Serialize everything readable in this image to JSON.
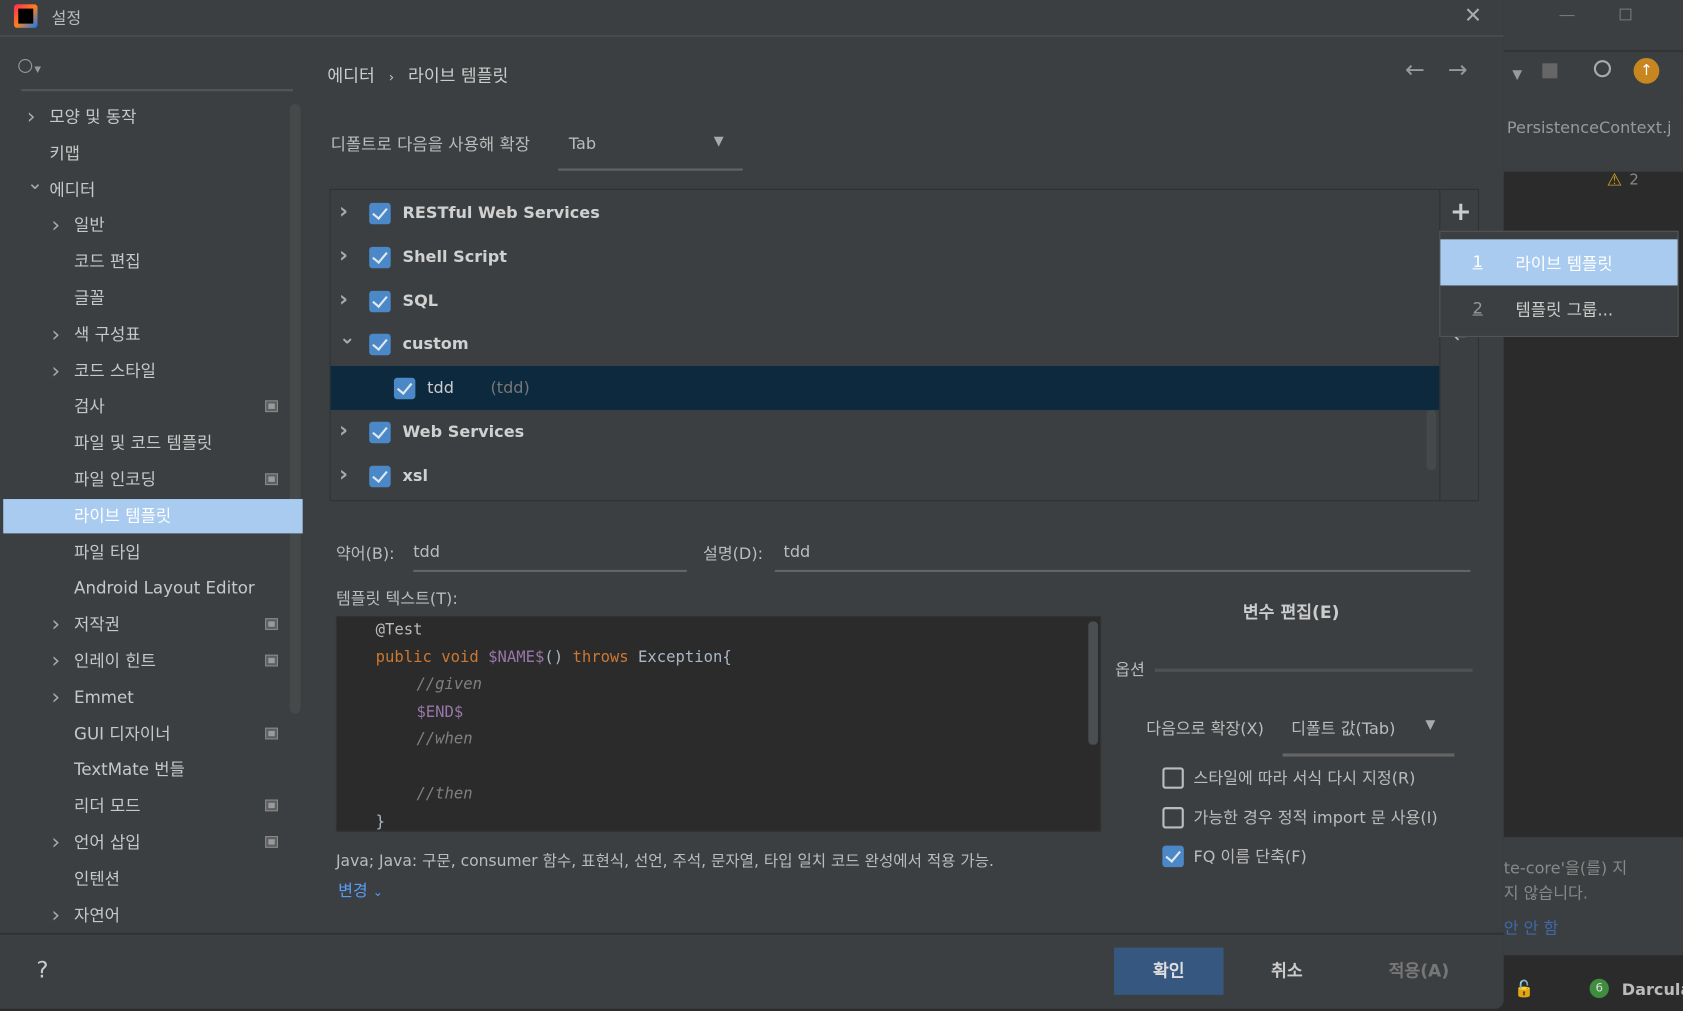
{
  "dialog": {
    "title": "설정",
    "help": "?"
  },
  "search": {
    "placeholder": ""
  },
  "sidebar": {
    "items": [
      {
        "label": "모양 및 동작",
        "expand": "collapsed",
        "level": 0
      },
      {
        "label": "키맵",
        "level": 0
      },
      {
        "label": "에디터",
        "expand": "expanded",
        "level": 0
      },
      {
        "label": "일반",
        "expand": "collapsed",
        "level": 1
      },
      {
        "label": "코드 편집",
        "level": 1
      },
      {
        "label": "글꼴",
        "level": 1
      },
      {
        "label": "색 구성표",
        "expand": "collapsed",
        "level": 1
      },
      {
        "label": "코드 스타일",
        "expand": "collapsed",
        "level": 1
      },
      {
        "label": "검사",
        "level": 1,
        "project_icon": true
      },
      {
        "label": "파일 및 코드 템플릿",
        "level": 1
      },
      {
        "label": "파일 인코딩",
        "level": 1,
        "project_icon": true
      },
      {
        "label": "라이브 템플릿",
        "level": 1,
        "selected": true
      },
      {
        "label": "파일 타입",
        "level": 1
      },
      {
        "label": "Android Layout Editor",
        "level": 1
      },
      {
        "label": "저작권",
        "expand": "collapsed",
        "level": 1,
        "project_icon": true
      },
      {
        "label": "인레이 힌트",
        "expand": "collapsed",
        "level": 1,
        "project_icon": true
      },
      {
        "label": "Emmet",
        "expand": "collapsed",
        "level": 1
      },
      {
        "label": "GUI 디자이너",
        "level": 1,
        "project_icon": true
      },
      {
        "label": "TextMate 번들",
        "level": 1
      },
      {
        "label": "리더 모드",
        "level": 1,
        "project_icon": true
      },
      {
        "label": "언어 삽입",
        "expand": "collapsed",
        "level": 1,
        "project_icon": true
      },
      {
        "label": "인텐션",
        "level": 1
      },
      {
        "label": "자연어",
        "expand": "collapsed",
        "level": 1
      }
    ]
  },
  "breadcrumb": [
    "에디터",
    "라이브 템플릿"
  ],
  "expand_default": {
    "label": "디폴트로 다음을 사용해 확장",
    "value": "Tab"
  },
  "template_groups": [
    {
      "label": "RESTful Web Services",
      "checked": true,
      "expand": "collapsed"
    },
    {
      "label": "Shell Script",
      "checked": true,
      "expand": "collapsed"
    },
    {
      "label": "SQL",
      "checked": true,
      "expand": "collapsed"
    },
    {
      "label": "custom",
      "checked": true,
      "expand": "expanded"
    },
    {
      "label": "tdd",
      "desc": "(tdd)",
      "checked": true,
      "child": true,
      "selected": true
    },
    {
      "label": "Web Services",
      "checked": true,
      "expand": "collapsed"
    },
    {
      "label": "xsl",
      "checked": true,
      "expand": "collapsed"
    }
  ],
  "add_menu": [
    {
      "num": "1",
      "label": "라이브 템플릿",
      "highlighted": true
    },
    {
      "num": "2",
      "label": "템플릿 그룹..."
    }
  ],
  "abbrev": {
    "label": "약어(B):",
    "value": "tdd"
  },
  "description": {
    "label": "설명(D):",
    "value": "tdd"
  },
  "template_text": {
    "label": "템플릿 텍스트(T):"
  },
  "code": {
    "l1": "@Test",
    "l2a": "public void ",
    "l2b": "$NAME$",
    "l2c": "() ",
    "l2d": "throws ",
    "l2e": "Exception{",
    "l3": "//given",
    "l4": "$END$",
    "l5": "//when",
    "l6": "//then",
    "l7": "}"
  },
  "applicable": "Java; Java: 구문, consumer 함수, 표현식, 선언, 주석, 문자열, 타입 일치 코드 완성에서 적용 가능.",
  "change_link": "변경",
  "edit_vars": "변수 편집(E)",
  "options": {
    "title": "옵션",
    "expand_label": "다음으로 확장(X)",
    "expand_value": "디폴트 값(Tab)",
    "checks": [
      {
        "label": "스타일에 따라 서식 다시 지정(R)",
        "checked": false
      },
      {
        "label": "가능한 경우 정적 import 문 사용(I)",
        "checked": false
      },
      {
        "label": "FQ 이름 단축(F)",
        "checked": true
      }
    ]
  },
  "buttons": {
    "ok": "확인",
    "cancel": "취소",
    "apply": "적용(A)"
  },
  "ide_bg": {
    "tab": "PersistenceContext.ja",
    "warnings": "2",
    "notif1": "te-core'을(를) 지",
    "notif2": "지 않습니다.",
    "notif3": "안 안 함",
    "status_count": "6",
    "theme": "Darcula"
  },
  "colors": {
    "accent": "#4a88c7",
    "selection": "#a8cbef",
    "tree_selection": "#0d293e",
    "ok_button": "#365880",
    "link": "#589df6"
  }
}
